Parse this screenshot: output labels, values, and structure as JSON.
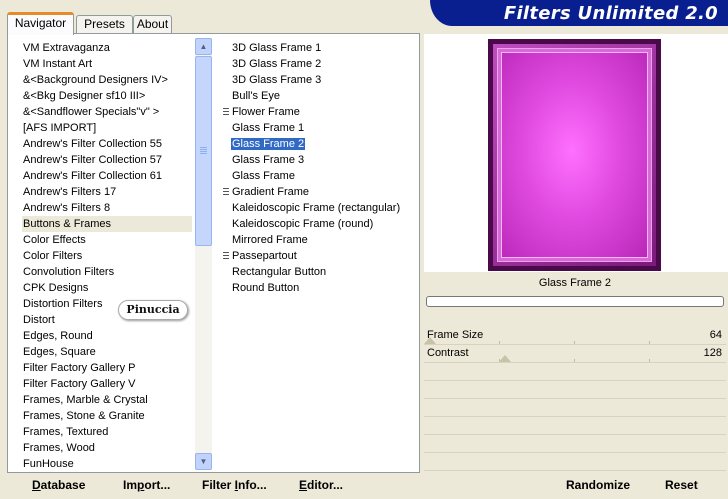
{
  "tabs": [
    "Navigator",
    "Presets",
    "About"
  ],
  "app_title": "Filters Unlimited 2.0",
  "categories": [
    "VM Extravaganza",
    "VM Instant Art",
    "&<Background Designers IV>",
    "&<Bkg Designer sf10 III>",
    "&<Sandflower Specials\"v\" >",
    "[AFS IMPORT]",
    "Andrew's Filter Collection 55",
    "Andrew's Filter Collection 57",
    "Andrew's Filter Collection 61",
    "Andrew's Filters 17",
    "Andrew's Filters 8",
    "Buttons & Frames",
    "Color Effects",
    "Color Filters",
    "Convolution Filters",
    "CPK Designs",
    "Distortion Filters",
    "Distort",
    "Edges, Round",
    "Edges, Square",
    "Filter Factory Gallery P",
    "Filter Factory Gallery V",
    "Frames, Marble & Crystal",
    "Frames, Stone & Granite",
    "Frames, Textured",
    "Frames, Wood",
    "FunHouse"
  ],
  "selected_category": "Buttons & Frames",
  "filters": [
    {
      "label": "3D Glass Frame 1",
      "group": false
    },
    {
      "label": "3D Glass Frame 2",
      "group": false
    },
    {
      "label": "3D Glass Frame 3",
      "group": false
    },
    {
      "label": "Bull's Eye",
      "group": false
    },
    {
      "label": "Flower Frame",
      "group": true
    },
    {
      "label": "Glass Frame 1",
      "group": false
    },
    {
      "label": "Glass Frame 2",
      "group": false
    },
    {
      "label": "Glass Frame 3",
      "group": false
    },
    {
      "label": "Glass Frame",
      "group": false
    },
    {
      "label": "Gradient Frame",
      "group": true
    },
    {
      "label": "Kaleidoscopic Frame (rectangular)",
      "group": false
    },
    {
      "label": "Kaleidoscopic Frame (round)",
      "group": false
    },
    {
      "label": "Mirrored Frame",
      "group": false
    },
    {
      "label": "Passepartout",
      "group": true
    },
    {
      "label": "Rectangular Button",
      "group": false
    },
    {
      "label": "Round Button",
      "group": false
    }
  ],
  "selected_filter": "Glass Frame 2",
  "watermark": "Pinuccia",
  "preview_caption": "Glass Frame 2",
  "sliders": [
    {
      "name": "Frame Size",
      "value": "64",
      "level": 0.25
    },
    {
      "name": "Contrast",
      "value": "128",
      "level": 0.5
    }
  ],
  "buttons": {
    "database": {
      "hot": "D",
      "rest": "atabase"
    },
    "import": {
      "pre": "Im",
      "hot": "p",
      "rest": "ort..."
    },
    "filter_info": {
      "pre": "Filter ",
      "hot": "I",
      "rest": "nfo..."
    },
    "editor": {
      "hot": "E",
      "rest": "ditor..."
    },
    "randomize": "Randomize",
    "reset": "Reset"
  },
  "colors": {
    "banner": "#0a1f8f",
    "selection": "#316ac5",
    "preview_magenta": "#e04ae0"
  }
}
